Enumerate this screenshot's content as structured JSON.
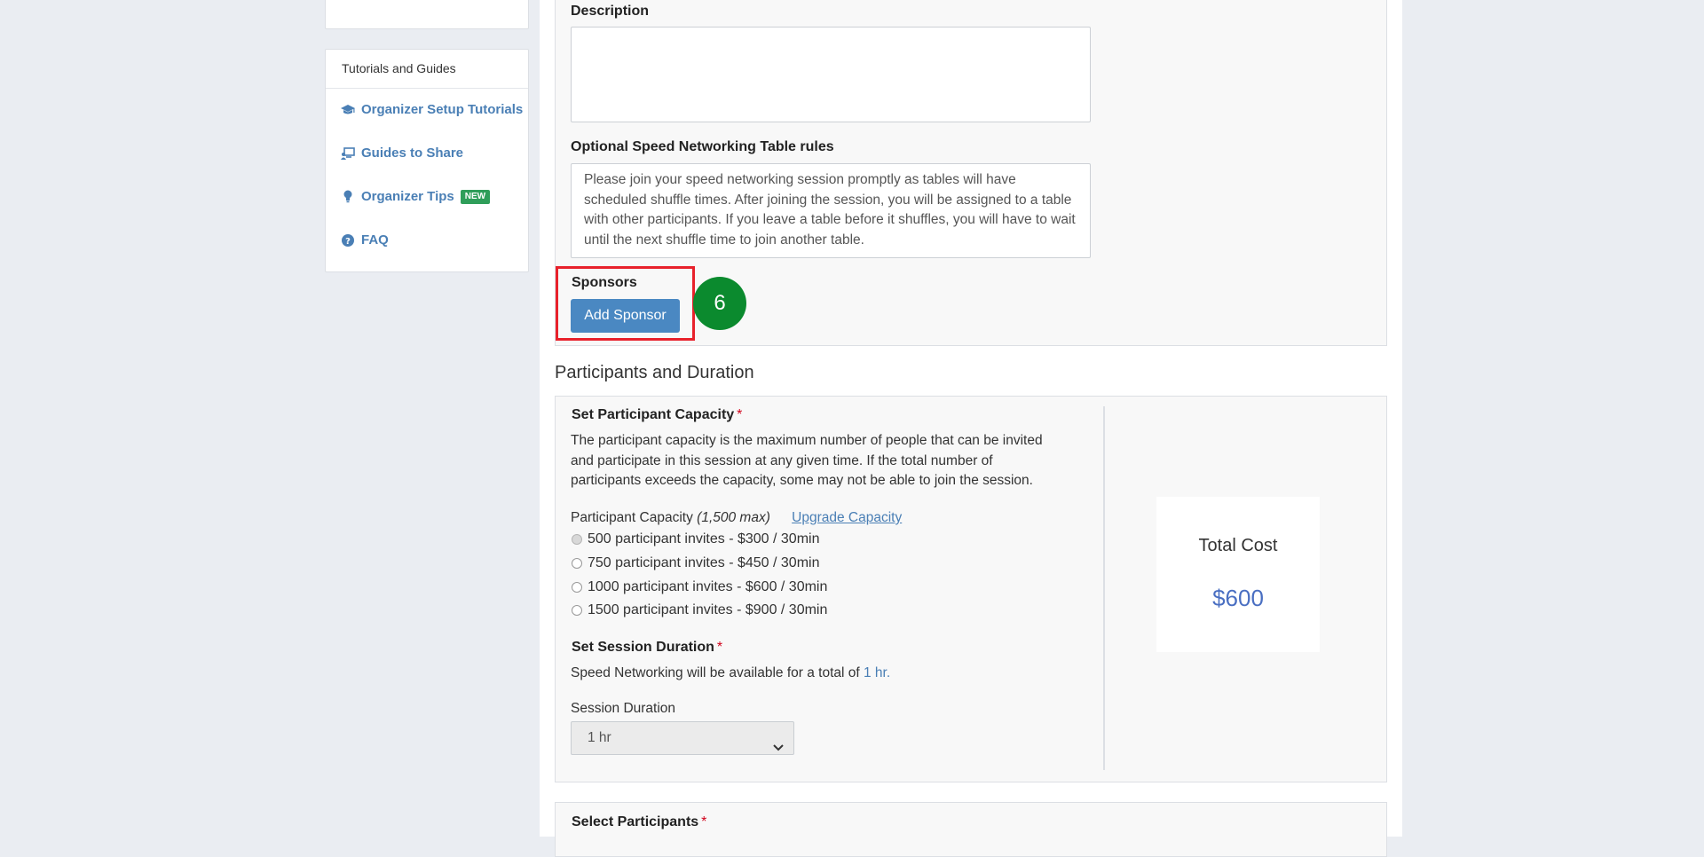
{
  "sidebar": {
    "top_card_partial_text": "",
    "guides_header": "Tutorials and Guides",
    "links": [
      {
        "label": "Organizer Setup Tutorials",
        "icon": "graduation-cap-icon"
      },
      {
        "label": "Guides to Share",
        "icon": "presentation-icon"
      },
      {
        "label": "Organizer Tips",
        "icon": "lightbulb-icon",
        "badge": "NEW"
      },
      {
        "label": "FAQ",
        "icon": "question-circle-icon"
      }
    ]
  },
  "details": {
    "description_label": "Description",
    "description_value": "",
    "rules_label": "Optional Speed Networking Table rules",
    "rules_value": "Please join your speed networking session promptly as tables will have scheduled shuffle times. After joining the session, you will be assigned to a table with other participants. If you leave a table before it shuffles, you will have to wait until the next shuffle time to join another table.",
    "sponsors_label": "Sponsors",
    "add_sponsor_label": "Add Sponsor",
    "step_number": "6"
  },
  "participants": {
    "section_title": "Participants and Duration",
    "capacity_label": "Set Participant Capacity",
    "required_mark": "*",
    "capacity_desc_lines": [
      "The participant capacity is the maximum number of people that can be invited",
      "and participate in this session at any given time. If the total number of",
      "participants exceeds the capacity, some may not be able to join the session."
    ],
    "capacity_field_label": "Participant Capacity",
    "capacity_max": "(1,500 max)",
    "upgrade_link": "Upgrade Capacity",
    "options": [
      {
        "label": "500 participant invites - $300 / 30min",
        "selected": true
      },
      {
        "label": "750 participant invites - $450 / 30min",
        "selected": false
      },
      {
        "label": "1000 participant invites - $600 / 30min",
        "selected": false
      },
      {
        "label": "1500 participant invites - $900 / 30min",
        "selected": false
      }
    ],
    "duration_label": "Set Session Duration",
    "duration_text": "Speed Networking will be available for a total of",
    "duration_value_link": "1 hr.",
    "session_duration_field_label": "Session Duration",
    "session_duration_selected": "1 hr",
    "total_cost_label": "Total Cost",
    "total_cost_value": "$600"
  },
  "select_participants": {
    "label": "Select Participants"
  },
  "colors": {
    "accent_link": "#4a7fb5",
    "button": "#4a88c2",
    "highlight": "#e8212b",
    "step_circle": "#0b8a2e",
    "badge_new": "#2f9e5a",
    "cost_value": "#4a6fc2"
  }
}
